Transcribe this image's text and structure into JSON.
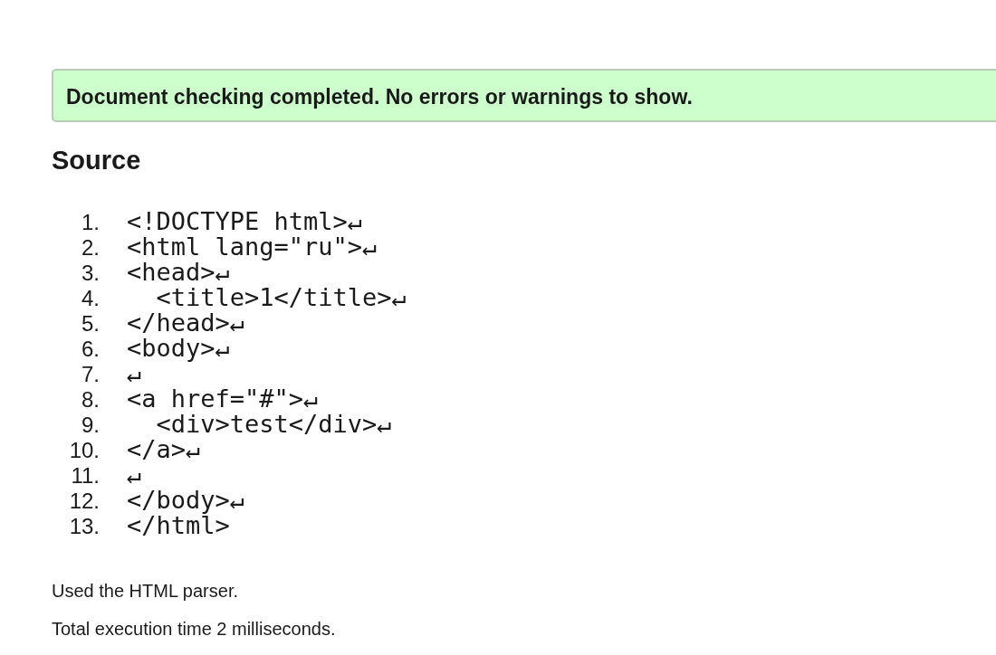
{
  "status_message": "Document checking completed. No errors or warnings to show.",
  "heading": "Source",
  "source_lines": [
    {
      "number": "1.",
      "text": "<!DOCTYPE html>↵"
    },
    {
      "number": "2.",
      "text": "<html lang=\"ru\">↵"
    },
    {
      "number": "3.",
      "text": "<head>↵"
    },
    {
      "number": "4.",
      "text": "  <title>1</title>↵"
    },
    {
      "number": "5.",
      "text": "</head>↵"
    },
    {
      "number": "6.",
      "text": "<body>↵"
    },
    {
      "number": "7.",
      "text": "↵"
    },
    {
      "number": "8.",
      "text": "<a href=\"#\">↵"
    },
    {
      "number": "9.",
      "text": "  <div>test</div>↵"
    },
    {
      "number": "10.",
      "text": "</a>↵"
    },
    {
      "number": "11.",
      "text": "↵"
    },
    {
      "number": "12.",
      "text": "</body>↵"
    },
    {
      "number": "13.",
      "text": "</html>"
    }
  ],
  "notes": [
    "Used the HTML parser.",
    "Total execution time 2 milliseconds."
  ]
}
